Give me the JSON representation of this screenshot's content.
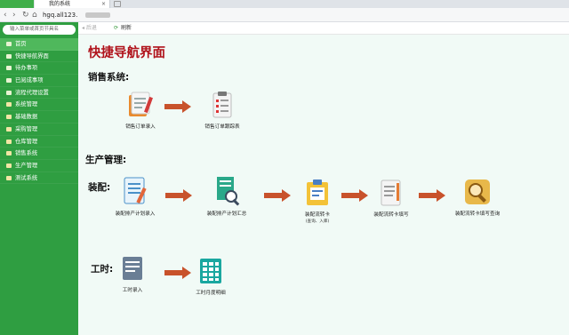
{
  "browser": {
    "tab_title": "我的系统",
    "tab_close": "×",
    "url": "hgq.all123.",
    "nav": {
      "back": "‹",
      "forward": "›",
      "reload": "↻",
      "home": "⌂"
    }
  },
  "toolbar": {
    "back_label": "◂ 后退",
    "refresh_icon": "⟳",
    "refresh_label": "刷新"
  },
  "sidebar": {
    "search_placeholder": "输入菜单或首页节具名",
    "items": [
      {
        "label": "首页",
        "icon": "home-icon",
        "active": true
      },
      {
        "label": "快捷导航界面",
        "icon": "doc-icon"
      },
      {
        "label": "待办事项",
        "icon": "doc-icon"
      },
      {
        "label": "已阅成事项",
        "icon": "doc-icon"
      },
      {
        "label": "流程代理设置",
        "icon": "doc-icon"
      },
      {
        "label": "系统管理",
        "icon": "folder-icon"
      },
      {
        "label": "基础数据",
        "icon": "folder-icon"
      },
      {
        "label": "采购管理",
        "icon": "folder-icon"
      },
      {
        "label": "仓库管理",
        "icon": "folder-icon"
      },
      {
        "label": "销售系统",
        "icon": "folder-icon"
      },
      {
        "label": "生产管理",
        "icon": "folder-icon"
      },
      {
        "label": "测试系统",
        "icon": "folder-icon"
      }
    ]
  },
  "main": {
    "title": "快捷导航界面",
    "sales": {
      "heading": "销售系统:",
      "items": [
        {
          "label": "销售订单录入",
          "icon": "order-entry-icon"
        },
        {
          "label": "销售订单跟踪表",
          "icon": "order-tracking-icon"
        }
      ]
    },
    "production": {
      "heading": "生产管理:",
      "assembly": {
        "heading": "装配:",
        "items": [
          {
            "label": "装配排产计划录入",
            "icon": "plan-entry-icon"
          },
          {
            "label": "装配排产计划汇总",
            "icon": "plan-summary-icon"
          },
          {
            "label": "装配流转卡",
            "sub": "(查询、入库)",
            "icon": "transfer-card-icon"
          },
          {
            "label": "装配流转卡填写",
            "icon": "card-fill-icon"
          },
          {
            "label": "装配流转卡填写查询",
            "icon": "card-search-icon"
          }
        ]
      },
      "worktime": {
        "heading": "工时:",
        "items": [
          {
            "label": "工时录入",
            "icon": "time-entry-icon"
          },
          {
            "label": "工时月度明细",
            "icon": "monthly-detail-icon"
          }
        ]
      }
    }
  },
  "colors": {
    "sidebar": "#2f9e41",
    "title": "#b0121b",
    "arrow": "#c8522b",
    "main_bg": "#f1faf6"
  }
}
